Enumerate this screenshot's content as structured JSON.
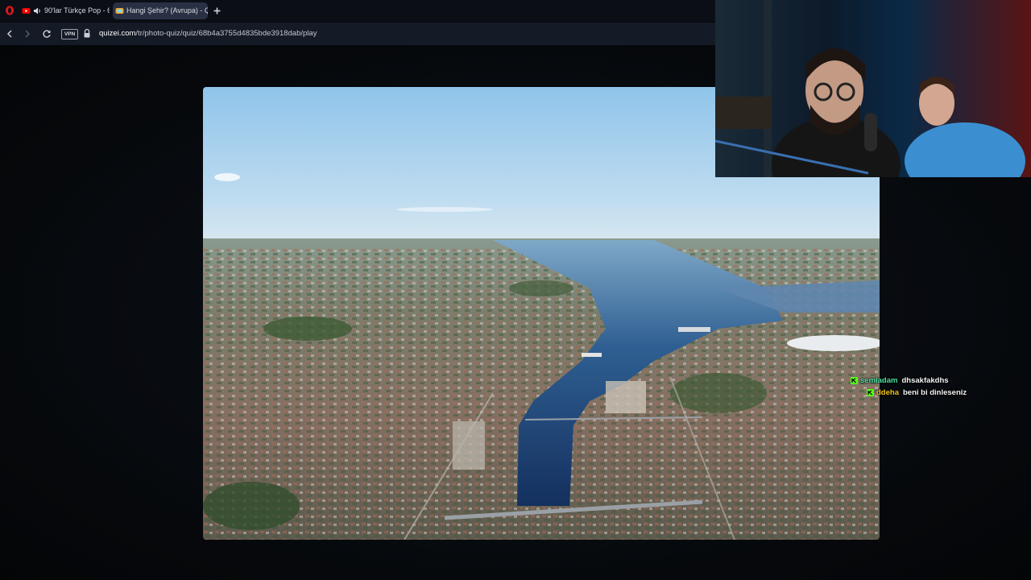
{
  "browser": {
    "tabs": [
      {
        "title": "90'lar Türkçe Pop - 6",
        "favicon": "youtube-icon",
        "audio": "speaker-icon",
        "active": false
      },
      {
        "title": "Hangi Şehir? (Avrupa) - Q",
        "favicon": "quizei-icon",
        "active": true
      }
    ],
    "new_tab_icon": "plus-icon",
    "address": {
      "vpn_label": "VPN",
      "url_host": "quizei.com",
      "url_path": "/tr/photo-quiz/quiz/68b4a3755d4835bde3918dab/play"
    }
  },
  "quiz": {
    "image": "aerial-harbor-city-photo"
  },
  "webcam": {
    "content": "streamer-webcam"
  },
  "chat": {
    "messages": [
      {
        "user": "semiadam",
        "text": "dhsakfakdhs",
        "user_color": "#4ee0a0"
      },
      {
        "user": "ddeha",
        "text": "beni bi dinleseniz",
        "user_color": "#f0c419"
      }
    ]
  },
  "colors": {
    "opera_red": "#e5161c",
    "youtube_red": "#ff0000",
    "chat_badge_green": "#53fc18"
  }
}
